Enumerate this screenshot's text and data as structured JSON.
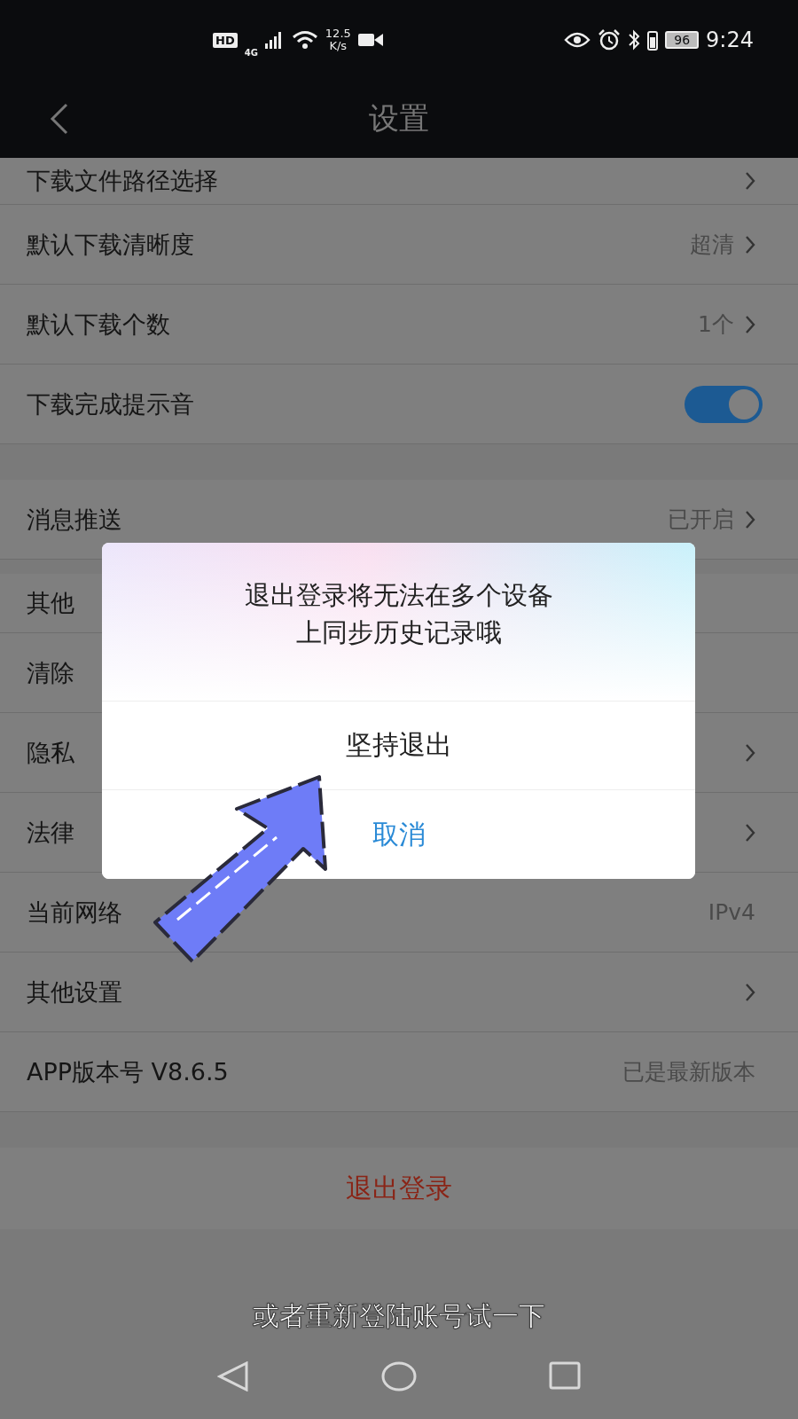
{
  "status_bar": {
    "hd": "HD",
    "network": "4G",
    "speed": "12.5",
    "speed_unit": "K/s",
    "battery": "96",
    "time": "9:24"
  },
  "header": {
    "title": "设置"
  },
  "groups": [
    {
      "rows": [
        {
          "kind": "link",
          "label": "下载文件路径选择"
        },
        {
          "kind": "link",
          "label": "默认下载清晰度",
          "value": "超清"
        },
        {
          "kind": "link",
          "label": "默认下载个数",
          "value": "1个"
        },
        {
          "kind": "toggle",
          "label": "下载完成提示音",
          "on": true
        }
      ]
    },
    {
      "rows": [
        {
          "kind": "link",
          "label": "消息推送",
          "value": "已开启"
        }
      ]
    },
    {
      "rows": [
        {
          "kind": "header",
          "label": "其他"
        },
        {
          "kind": "plain",
          "label": "清除"
        },
        {
          "kind": "link",
          "label": "隐私"
        },
        {
          "kind": "link",
          "label": "法律"
        },
        {
          "kind": "value",
          "label": "当前网络",
          "value": "IPv4"
        },
        {
          "kind": "link",
          "label": "其他设置"
        },
        {
          "kind": "value",
          "label": "APP版本号 V8.6.5",
          "value": "已是最新版本"
        }
      ]
    }
  ],
  "logout": "退出登录",
  "dialog": {
    "message_lines": [
      "退出登录将无法在多个设备",
      "上同步历史记录哦"
    ],
    "confirm": "坚持退出",
    "cancel": "取消"
  },
  "subtitle": "或者重新登陆账号试一下"
}
